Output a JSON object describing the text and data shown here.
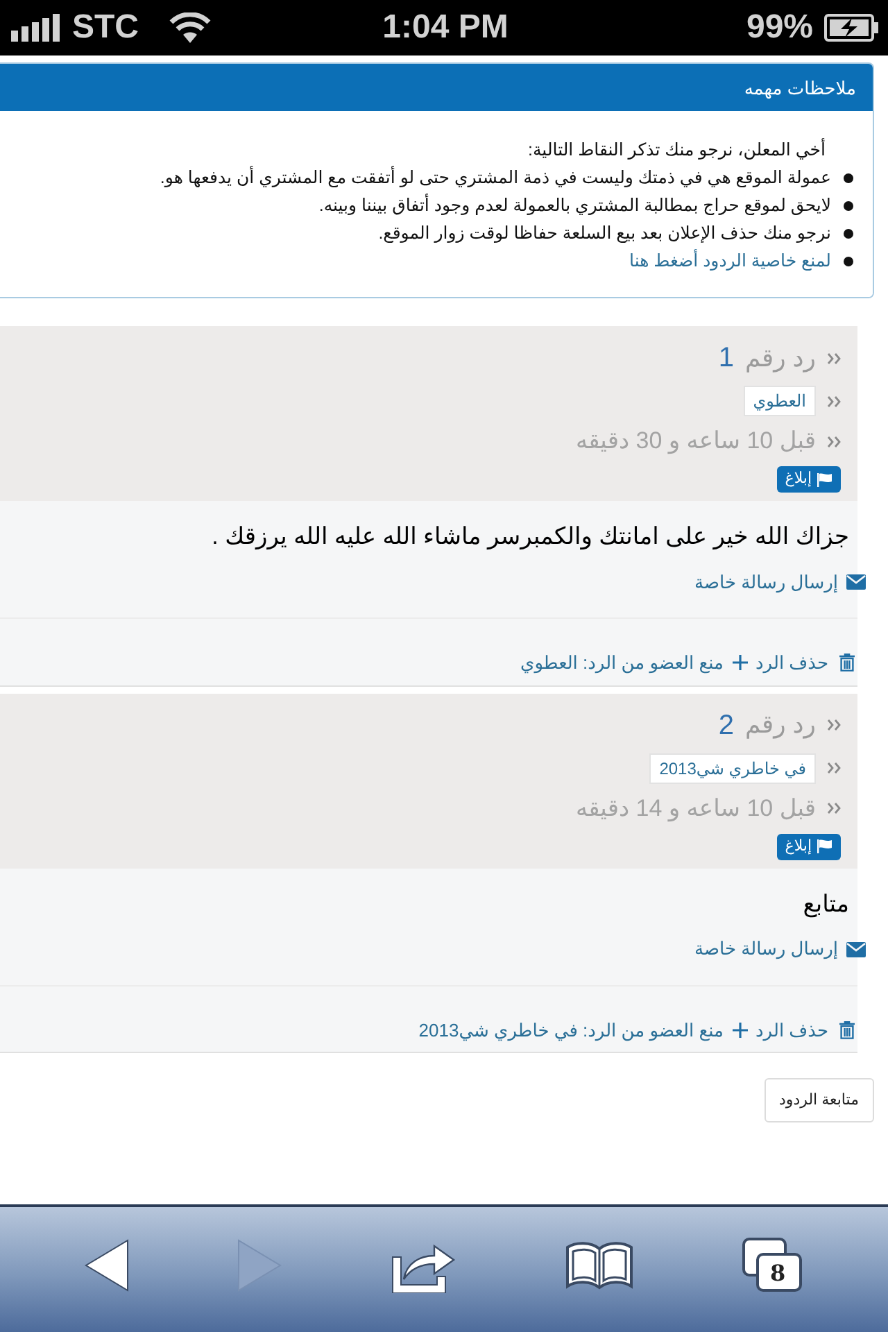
{
  "status_bar": {
    "carrier": "STC",
    "time": "1:04 PM",
    "battery": "99%"
  },
  "notice": {
    "title": "ملاحظات مهمه",
    "intro": "أخي المعلن، نرجو منك تذكر النقاط التالية:",
    "items": [
      {
        "kind": "text",
        "text": "عمولة الموقع هي في ذمتك وليست في ذمة المشتري حتى لو أتفقت مع المشتري أن يدفعها هو."
      },
      {
        "kind": "text",
        "text": "لايحق لموقع حراج بمطالبة المشتري بالعمولة لعدم وجود أتفاق بيننا وبينه."
      },
      {
        "kind": "text",
        "text": "نرجو منك حذف الإعلان بعد بيع السلعة حفاظا لوقت زوار الموقع."
      },
      {
        "kind": "link",
        "text": "لمنع خاصية الردود أضغط هنا"
      }
    ]
  },
  "replies": [
    {
      "label": "رد رقم",
      "number": "1",
      "user": "العطوي",
      "time": "قبل 10 ساعه و 30 دقيقه",
      "report": "إبلاغ",
      "body": "جزاك الله خير على امانتك والكمبرسر ماشاء الله عليه الله يرزقك .",
      "message_link": "إرسال رسالة خاصة",
      "delete": "حذف الرد",
      "ban": "منع العضو من الرد: العطوي"
    },
    {
      "label": "رد رقم",
      "number": "2",
      "user": "في خاطري شي2013",
      "time": "قبل 10 ساعه و 14 دقيقه",
      "report": "إبلاغ",
      "body": "متابع",
      "message_link": "إرسال رسالة خاصة",
      "delete": "حذف الرد",
      "ban": "منع العضو من الرد: في خاطري شي2013"
    }
  ],
  "follow_button": "متابعة الردود",
  "toolbar": [
    {
      "kind": "back",
      "disabled": false
    },
    {
      "kind": "forward",
      "disabled": true
    },
    {
      "kind": "share",
      "disabled": false
    },
    {
      "kind": "bookmarks",
      "disabled": false
    },
    {
      "kind": "tabs",
      "disabled": false,
      "count": "8"
    }
  ]
}
